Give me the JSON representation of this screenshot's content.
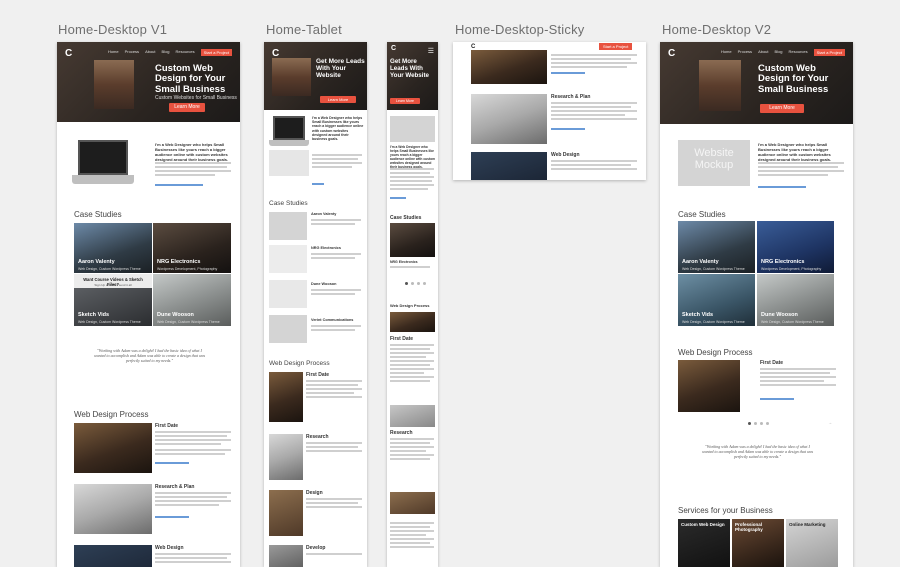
{
  "artboards": {
    "desktop_v1": "Home-Desktop V1",
    "tablet": "Home-Tablet",
    "desktop_sticky": "Home-Desktop-Sticky",
    "desktop_v2": "Home-Desktop V2"
  },
  "hero": {
    "logo": "C",
    "nav": [
      "Home",
      "Process",
      "About",
      "Blog",
      "Resources"
    ],
    "nav_cta": "Start a Project",
    "title_desktop": "Custom Web Design for Your Small Business",
    "title_mobile": "Get More Leads With Your Website",
    "subtitle": "Custom Websites for Small Business",
    "button": "Learn More"
  },
  "intro": {
    "text": "I'm a Web Designer who helps Small Businesses like yours reach a bigger audience online with custom websites designed around their business goals."
  },
  "sections": {
    "case_studies": "Case Studies",
    "web_design_process": "Web Design Process",
    "services": "Services for your Business"
  },
  "case_studies": [
    {
      "name": "Aaron Valenty",
      "tags": "Web Design, Custom Wordpress Theme"
    },
    {
      "name": "NRG Electronics",
      "tags": "Wordpress Development, Photography"
    },
    {
      "name": "Sketch Vids",
      "tags": "Web Design, Custom Wordpress Theme"
    },
    {
      "name": "Dune Wooson",
      "tags": "Web Design, Custom Wordpress Theme"
    }
  ],
  "case_overlay": {
    "title": "Want Course Videos & Sketch Files?",
    "subtitle": "Sign Up and We'll send it all"
  },
  "tablet_cases": [
    "Aaron Valenty",
    "NRG Electronics",
    "Dune Wooson",
    "Verint Communications"
  ],
  "process_steps": [
    "First Date",
    "Research & Plan",
    "Web Design"
  ],
  "tablet_steps": [
    "First Date",
    "Research",
    "Design",
    "Develop"
  ],
  "mobile_steps": [
    "First Date",
    "Research"
  ],
  "quote": "\"Working with Adam was a delight! I had the basic idea of what I wanted to accomplish and Adam was able to create a design that was perfectly suited to my needs.\"",
  "sticky": {
    "badge": "Start a Project",
    "step1": "Research & Plan",
    "step2": "Web Design"
  },
  "v2": {
    "mockup_text": "Website Mockup",
    "services": [
      "Custom Web Design",
      "Professional Photography",
      "Online Marketing"
    ]
  },
  "colors": {
    "accent": "#e8523f",
    "link": "#6a9bd8"
  }
}
